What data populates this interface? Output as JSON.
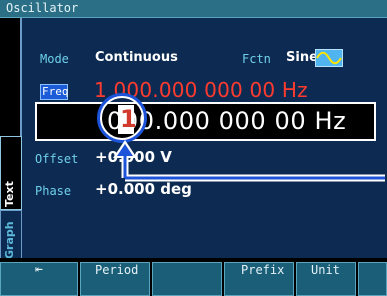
{
  "window": {
    "title": "Oscillator"
  },
  "params": {
    "mode_label": "Mode",
    "mode_value": "Continuous",
    "fctn_label": "Fctn",
    "fctn_value": "Sine",
    "freq_label": "Freq",
    "freq_value": "1 000.000 000 00 Hz",
    "offset_label": "Offset",
    "offset_value": "+0.000 V",
    "phase_label": "Phase",
    "phase_value": "+0.000 deg"
  },
  "editor": {
    "cursor_digit": "1",
    "value_rest": "000.000 000 00  Hz"
  },
  "side_tabs": {
    "text": "Text",
    "graph": "Graph"
  },
  "softkeys": {
    "back_glyph": "⇤",
    "period": "Period",
    "prefix": "Prefix",
    "unit": "Unit"
  },
  "colors": {
    "titlebar": "#2a6f86",
    "panel": "#0d2b52",
    "freq": "#ff3b2f",
    "highlight": "#1b5bd8"
  }
}
